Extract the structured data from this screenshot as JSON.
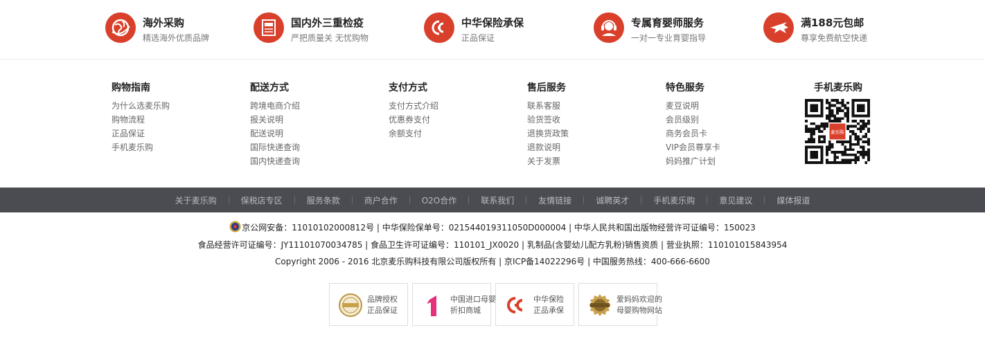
{
  "features": [
    {
      "title": "海外采购",
      "subtitle": "精选海外优质品牌",
      "icon": "globe-icon"
    },
    {
      "title": "国内外三重检疫",
      "subtitle": "严把质量关 无忧购物",
      "icon": "document-icon"
    },
    {
      "title": "中华保险承保",
      "subtitle": "正品保证",
      "icon": "insurance-logo-icon"
    },
    {
      "title": "专属育婴师服务",
      "subtitle": "一对一专业育婴指导",
      "icon": "headset-icon"
    },
    {
      "title": "满188元包邮",
      "subtitle": "尊享免费航空快递",
      "icon": "airplane-icon"
    }
  ],
  "columns": [
    {
      "heading": "购物指南",
      "links": [
        "为什么选麦乐购",
        "购物流程",
        "正品保证",
        "手机麦乐购"
      ]
    },
    {
      "heading": "配送方式",
      "links": [
        "跨境电商介绍",
        "报关说明",
        "配送说明",
        "国际快递查询",
        "国内快递查询"
      ]
    },
    {
      "heading": "支付方式",
      "links": [
        "支付方式介绍",
        "优惠券支付",
        "余额支付"
      ]
    },
    {
      "heading": "售后服务",
      "links": [
        "联系客服",
        "验货签收",
        "退换货政策",
        "退款说明",
        "关于发票"
      ]
    },
    {
      "heading": "特色服务",
      "links": [
        "麦豆说明",
        "会员级别",
        "商务会员卡",
        "VIP会员尊享卡",
        "妈妈推广计划"
      ]
    }
  ],
  "mobile": {
    "heading": "手机麦乐购",
    "qr_label": "麦乐购"
  },
  "nav": [
    "关于麦乐购",
    "保税店专区",
    "服务条款",
    "商户合作",
    "O2O合作",
    "联系我们",
    "友情链接",
    "诚聘英才",
    "手机麦乐购",
    "意见建议",
    "媒体报道"
  ],
  "license": {
    "line1": "京公网安备：11010102000812号 | 中华保险保单号：021544019311050D000004 | 中华人民共和国出版物经营许可证编号：150023",
    "line2": "食品经营许可证编号：JY11101070034785 | 食品卫生许可证编号：110101_JX0020 | 乳制品(含婴幼儿配方乳粉)销售资质 | 营业执照：110101015843954",
    "line3": "Copyright 2006 - 2016 北京麦乐购科技有限公司版权所有 | 京ICP备14022296号 | 中国服务热线：400-666-6600"
  },
  "badges": [
    {
      "line1": "品牌授权",
      "line2": "正品保证",
      "icon": "brand-seal-icon"
    },
    {
      "line1": "中国进口母婴",
      "line2": "折扣商城",
      "icon": "pink-one-icon"
    },
    {
      "line1": "中华保险",
      "line2": "正品承保",
      "icon": "insurance-logo-icon"
    },
    {
      "line1": "爱妈妈欢迎的",
      "line2": "母婴购物网站",
      "icon": "gold-medal-icon"
    }
  ],
  "colors": {
    "accent": "#d9402b",
    "navbar": "#4a4c52"
  }
}
